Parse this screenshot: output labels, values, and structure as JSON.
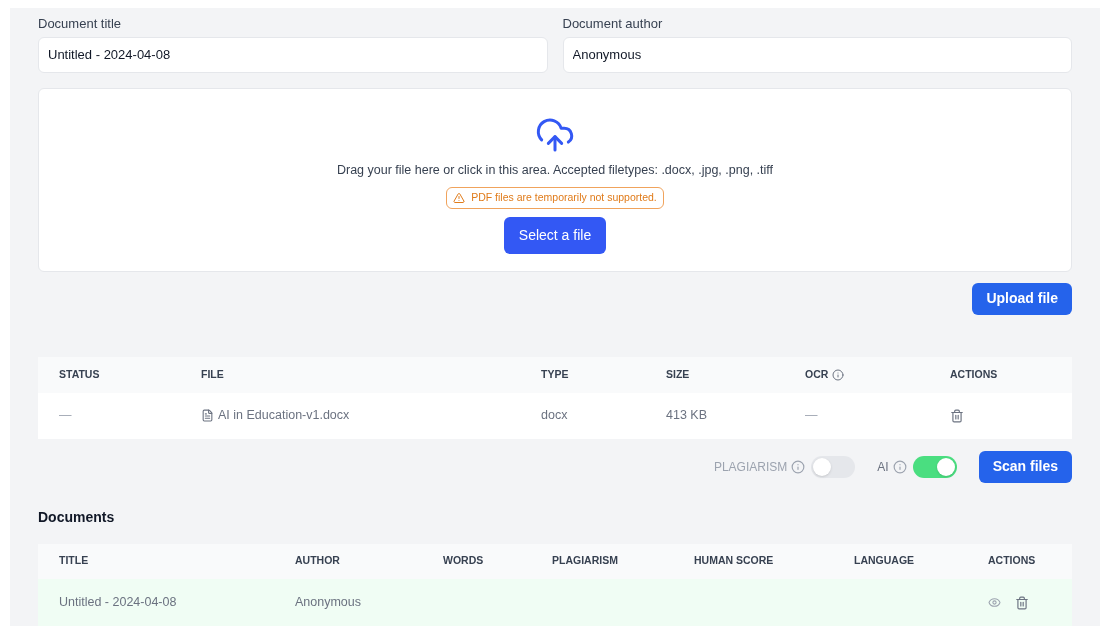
{
  "fields": [
    {
      "label": "Document title",
      "value": "Untitled - 2024-04-08"
    },
    {
      "label": "Document author",
      "value": "Anonymous"
    }
  ],
  "dropzone": {
    "instructions": "Drag your file here or click in this area. Accepted filetypes: .docx, .jpg, .png, .tiff",
    "warning": "PDF files are temporarily not supported.",
    "button": "Select a file"
  },
  "upload_button": "Upload file",
  "files_table": {
    "columns": [
      {
        "label": "STATUS",
        "kind": "plain"
      },
      {
        "label": "FILE",
        "kind": "plain"
      },
      {
        "label": "TYPE",
        "kind": "plain"
      },
      {
        "label": "SIZE",
        "kind": "plain"
      },
      {
        "label": "OCR",
        "kind": "info"
      },
      {
        "label": "ACTIONS",
        "kind": "plain"
      }
    ],
    "rows": [
      {
        "status": "—",
        "file": "AI in Education-v1.docx",
        "type": "docx",
        "size": "413 KB",
        "ocr": "—"
      }
    ]
  },
  "toggles": [
    {
      "label": "PLAGIARISM",
      "on": false
    },
    {
      "label": "AI",
      "on": true
    }
  ],
  "scan_button": "Scan files",
  "documents": {
    "title": "Documents",
    "columns": [
      "TITLE",
      "AUTHOR",
      "WORDS",
      "PLAGIARISM",
      "HUMAN SCORE",
      "LANGUAGE",
      "ACTIONS"
    ],
    "rows": [
      {
        "title": "Untitled - 2024-04-08",
        "author": "Anonymous"
      }
    ]
  }
}
